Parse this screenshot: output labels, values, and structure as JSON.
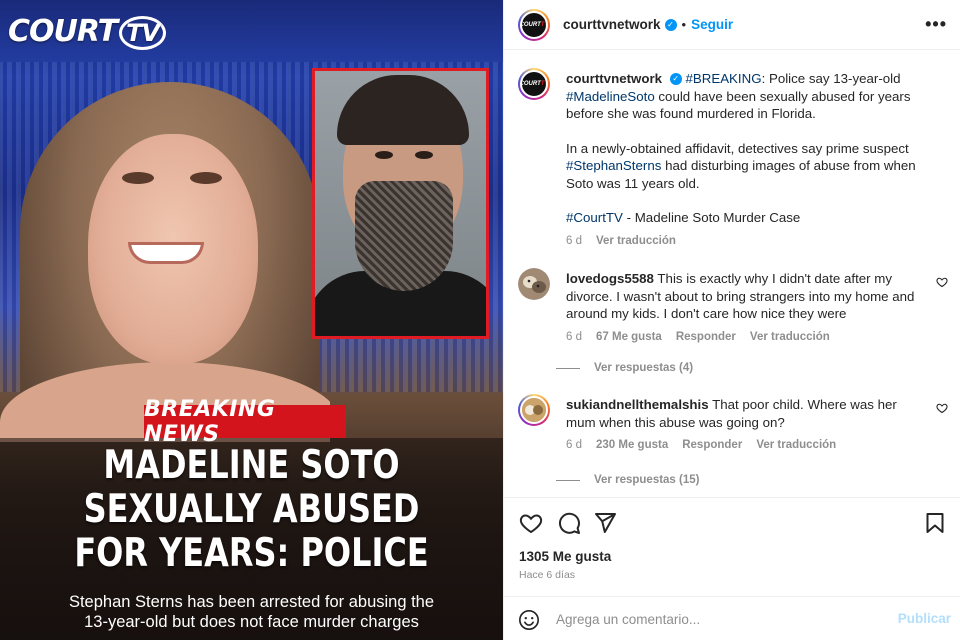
{
  "image": {
    "brand": "COURT",
    "brand_tv": "TV",
    "banner": "BREAKING NEWS",
    "headline": [
      "MADELINE SOTO",
      "SEXUALLY ABUSED",
      "FOR YEARS: POLICE"
    ],
    "caption": [
      "Stephan Sterns has been arrested for abusing the",
      "13-year-old but does not face murder charges"
    ]
  },
  "header": {
    "username": "courttvnetwork",
    "separator": "•",
    "follow_label": "Seguir",
    "more_label": "•••"
  },
  "post": {
    "username": "courttvnetwork",
    "tag_breaking": "#BREAKING",
    "text_1": ": Police say 13-year-old ",
    "tag_madeline": "#MadelineSoto",
    "text_2": " could have been sexually abused for years before she was found murdered in Florida.",
    "text_3": "In a newly-obtained affidavit, detectives say prime suspect ",
    "tag_stephan": "#StephanSterns",
    "text_4": " had disturbing images of abuse from when Soto was 11 years old.",
    "tag_courttv": "#CourtTV",
    "text_5": " - Madeline Soto Murder Case",
    "time": "6 d",
    "translate": "Ver traducción"
  },
  "comments": [
    {
      "username": "lovedogs5588",
      "text": "This is exactly why I didn't date after my divorce. I wasn't about to bring strangers into my home and around my kids. I don't care how nice they were",
      "time": "6 d",
      "likes": "67 Me gusta",
      "reply": "Responder",
      "translate": "Ver traducción",
      "view_replies": "Ver respuestas (4)"
    },
    {
      "username": "sukiandnellthemalshis",
      "text": "That poor child. Where was her mum when this abuse was going on?",
      "time": "6 d",
      "likes": "230 Me gusta",
      "reply": "Responder",
      "translate": "Ver traducción",
      "view_replies": "Ver respuestas (15)"
    }
  ],
  "footer": {
    "likes": "1305 Me gusta",
    "ago": "Hace 6 días",
    "comment_placeholder": "Agrega un comentario...",
    "publish": "Publicar"
  },
  "icons": {
    "like": "heart-icon",
    "comment": "comment-icon",
    "share": "send-icon",
    "save": "bookmark-icon",
    "emoji": "emoji-icon"
  },
  "colors": {
    "accent": "#0095f6",
    "hashtag": "#00376b",
    "breaking_red": "#d4141c",
    "muted": "#8e8e8e"
  }
}
